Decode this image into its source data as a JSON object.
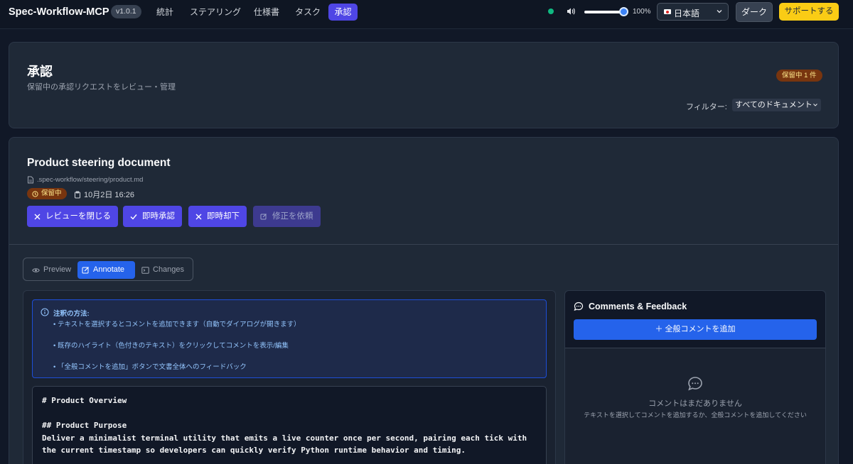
{
  "nav": {
    "brand": "Spec-Workflow-MCP",
    "version": "v1.0.1",
    "items": [
      {
        "label": "統計",
        "active": false
      },
      {
        "label": "ステアリング",
        "active": false
      },
      {
        "label": "仕様書",
        "active": false
      },
      {
        "label": "タスク",
        "active": false
      },
      {
        "label": "承認",
        "active": true
      }
    ],
    "volume": "100%",
    "volume_level": 1.0,
    "language": "日本語",
    "theme_button": "ダーク",
    "support_button": "サポートする",
    "status_color": "#10b981"
  },
  "header": {
    "title": "承認",
    "subtitle": "保留中の承認リクエストをレビュー・管理",
    "pending_badge": "保留中 1 件",
    "filter_label": "フィルター:",
    "filter_value": "すべてのドキュメント"
  },
  "document": {
    "title": "Product steering document",
    "path": ".spec-workflow/steering/product.md",
    "status": "保留中",
    "date": "10月2日 16:26",
    "actions": {
      "close_review": "レビューを閉じる",
      "approve": "即時承認",
      "reject": "即時却下",
      "request_changes": "修正を依頼"
    },
    "tabs": {
      "preview": "Preview",
      "annotate": "Annotate",
      "changes": "Changes"
    },
    "info": {
      "heading": "注釈の方法:",
      "line1": "• テキストを選択するとコメントを追加できます（自動でダイアログが開きます）",
      "line2": "• 既存のハイライト（色付きのテキスト）をクリックしてコメントを表示/編集",
      "line3": "• 「全般コメントを追加」ボタンで文書全体へのフィードバック"
    },
    "content": {
      "h1": "# Product Overview",
      "h2": "## Product Purpose",
      "p1": "Deliver a minimalist terminal utility that emits a live counter once per second, pairing each tick with",
      "p2": "the current timestamp so developers can quickly verify Python runtime behavior and timing."
    }
  },
  "comments": {
    "title": "Comments & Feedback",
    "add_button": "＋ 全般コメントを追加",
    "empty_title": "コメントはまだありません",
    "empty_sub": "テキストを選択してコメントを追加するか、全般コメントを追加してください"
  }
}
